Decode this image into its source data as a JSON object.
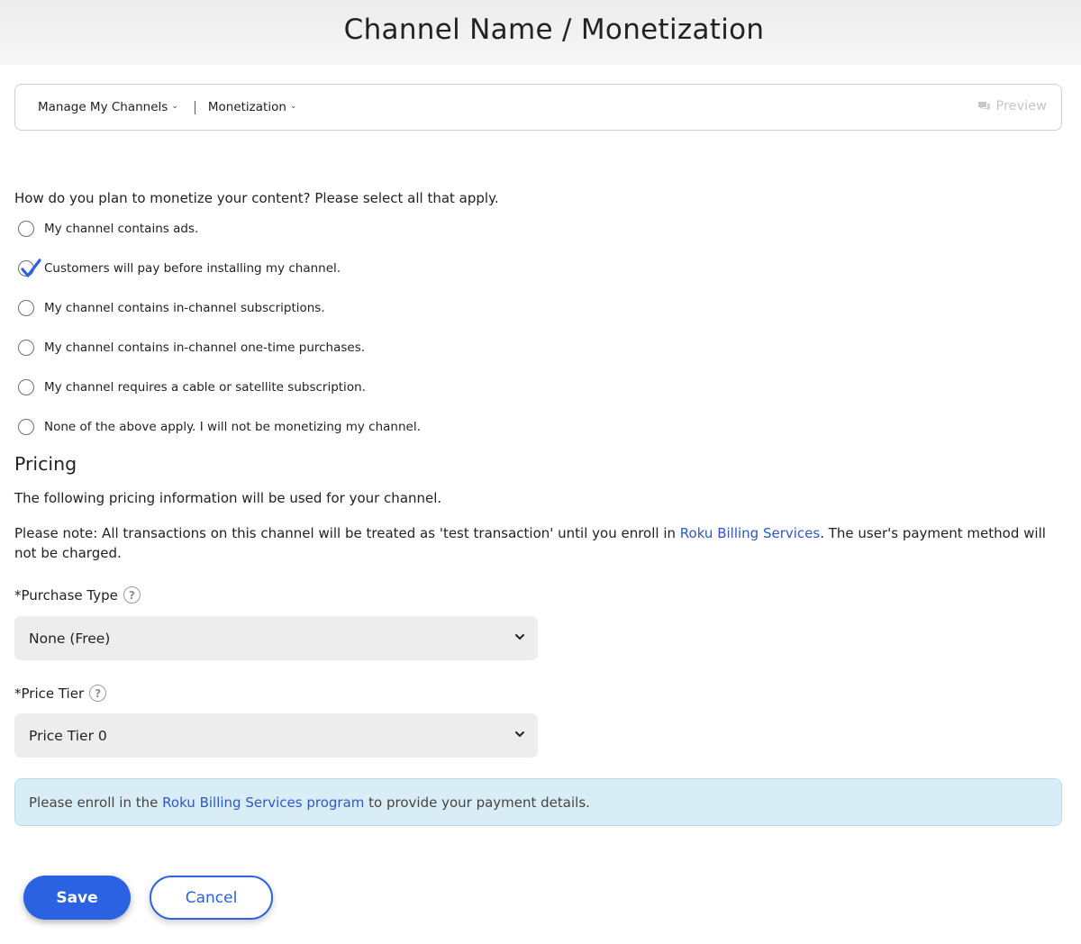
{
  "header": {
    "title": "Channel Name / Monetization"
  },
  "nav": {
    "items": [
      {
        "label": "Manage My Channels"
      },
      {
        "label": "Monetization"
      }
    ],
    "preview_label": "Preview"
  },
  "monetization": {
    "question": "How do you plan to monetize your content? Please select all that apply.",
    "options": [
      {
        "label": "My channel contains ads.",
        "checked": false
      },
      {
        "label": "Customers will pay before installing my channel.",
        "checked": true
      },
      {
        "label": "My channel contains in-channel subscriptions.",
        "checked": false
      },
      {
        "label": "My channel contains in-channel one-time purchases.",
        "checked": false
      },
      {
        "label": "My channel requires a cable or satellite subscription.",
        "checked": false
      },
      {
        "label": "None of the above apply. I will not be monetizing my channel.",
        "checked": false
      }
    ]
  },
  "pricing": {
    "title": "Pricing",
    "description": "The following pricing information will be used for your channel.",
    "note_prefix": "Please note: All transactions on this channel will be treated as 'test transaction' until you enroll in ",
    "note_link": "Roku Billing Services",
    "note_suffix": ". The user's payment method will not be charged.",
    "purchase_type": {
      "label": "*Purchase Type",
      "value": "None (Free)"
    },
    "price_tier": {
      "label": "*Price Tier",
      "value": "Price Tier 0"
    }
  },
  "info": {
    "prefix": "Please enroll in the ",
    "link": "Roku Billing Services program",
    "suffix": " to provide your payment details."
  },
  "buttons": {
    "save": "Save",
    "cancel": "Cancel"
  },
  "colors": {
    "accent": "#2a62e2",
    "link": "#2f57c7",
    "info_bg": "#d9edf6",
    "select_bg": "#ededed"
  }
}
